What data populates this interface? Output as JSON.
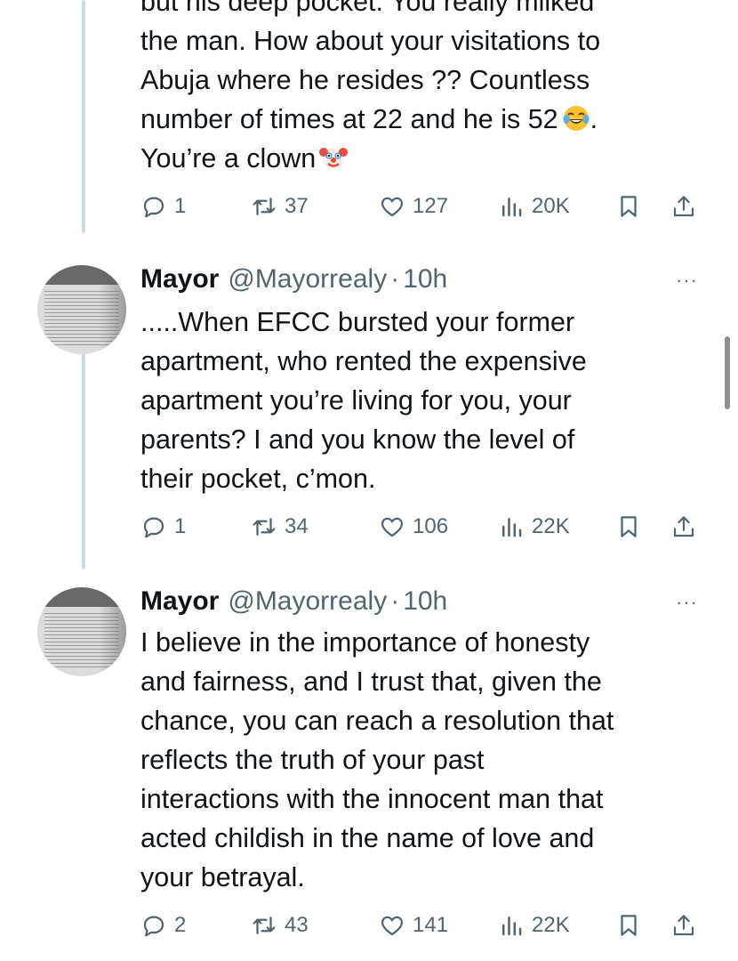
{
  "tweets": [
    {
      "lines": [
        "but his deep pocket. You really milked",
        "the man. How about your visitations to",
        "Abuja where he resides ?? Countless",
        "number of times at 22 and he is 52",
        "You’re a clown"
      ],
      "stats": {
        "replies": "1",
        "reposts": "37",
        "likes": "127",
        "views": "20K"
      }
    },
    {
      "name": "Mayor",
      "handle": "@Mayorrealy",
      "dot": "·",
      "time": "10h",
      "lines": [
        ".....When EFCC bursted your former",
        "apartment, who rented the expensive",
        "apartment you’re living for you, your",
        "parents? I and you know the level of",
        "their pocket, c’mon."
      ],
      "stats": {
        "replies": "1",
        "reposts": "34",
        "likes": "106",
        "views": "22K"
      }
    },
    {
      "name": "Mayor",
      "handle": "@Mayorrealy",
      "dot": "·",
      "time": "10h",
      "lines": [
        "I believe in the importance of honesty",
        "and fairness, and I trust that, given the",
        "chance, you can reach a resolution that",
        "reflects the truth of your past",
        "interactions with the innocent man that",
        "acted childish in the name of love and",
        "your betrayal."
      ],
      "stats": {
        "replies": "2",
        "reposts": "43",
        "likes": "141",
        "views": "22K"
      }
    }
  ],
  "icons": {
    "reply": "reply-icon",
    "repost": "repost-icon",
    "like": "heart-icon",
    "views": "views-icon",
    "bookmark": "bookmark-icon",
    "share": "share-icon",
    "more": "more-icon",
    "emoji_laugh": "tears-of-joy-emoji",
    "emoji_clown": "clown-face-emoji"
  },
  "colors": {
    "text": "#0f1419",
    "secondary": "#536471",
    "thread_line": "#cfd9de"
  },
  "more_label": "···"
}
